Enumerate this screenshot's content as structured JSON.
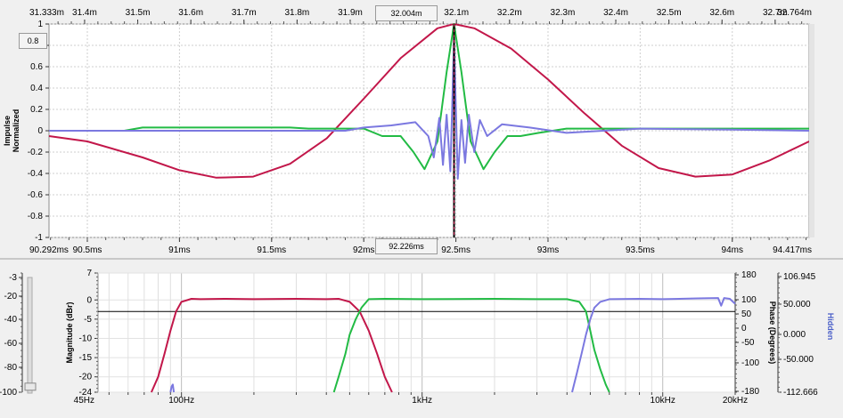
{
  "chart_data": [
    {
      "type": "line",
      "panel": "impulse",
      "ylabel": [
        "Impulse",
        "Normalized"
      ],
      "ylim": [
        -1,
        1
      ],
      "yticks": [
        "1",
        "0.8",
        "0.6",
        "0.4",
        "0.2",
        "0",
        "-0.2",
        "-0.4",
        "-0.6",
        "-0.8",
        "-1"
      ],
      "top_axis": {
        "start": "31.333m",
        "end": "32.764m",
        "ticks": [
          "31.4m",
          "31.5m",
          "31.6m",
          "31.7m",
          "31.8m",
          "31.9m",
          "32.1m",
          "32.2m",
          "32.3m",
          "32.4m",
          "32.5m",
          "32.6m",
          "32.7m"
        ],
        "marker": "32.004m"
      },
      "bottom_axis": {
        "start": "90.292ms",
        "end": "94.417ms",
        "ticks": [
          "90.5ms",
          "91ms",
          "91.5ms",
          "92ms",
          "92.5ms",
          "93ms",
          "93.5ms",
          "94ms"
        ],
        "marker": "92.226ms"
      },
      "left_box": "0.8",
      "cursor_ms": 92.49,
      "grid": true,
      "series": [
        {
          "color": "#c2174a",
          "x": [
            90.292,
            90.5,
            90.8,
            91.0,
            91.2,
            91.4,
            91.6,
            91.8,
            92.0,
            92.2,
            92.4,
            92.49,
            92.6,
            92.8,
            93.0,
            93.2,
            93.4,
            93.6,
            93.8,
            94.0,
            94.2,
            94.417
          ],
          "y": [
            -0.05,
            -0.1,
            -0.25,
            -0.37,
            -0.44,
            -0.43,
            -0.31,
            -0.07,
            0.3,
            0.68,
            0.96,
            1.0,
            0.96,
            0.77,
            0.48,
            0.16,
            -0.14,
            -0.35,
            -0.43,
            -0.41,
            -0.28,
            -0.1
          ]
        },
        {
          "color": "#22bb44",
          "x": [
            90.292,
            90.7,
            90.8,
            91.6,
            91.7,
            92.0,
            92.1,
            92.2,
            92.27,
            92.33,
            92.4,
            92.45,
            92.49,
            92.53,
            92.58,
            92.65,
            92.71,
            92.78,
            92.85,
            92.95,
            93.1,
            94.417
          ],
          "y": [
            0.0,
            0.0,
            0.03,
            0.03,
            0.02,
            0.02,
            -0.05,
            -0.05,
            -0.2,
            -0.36,
            -0.1,
            0.55,
            1.0,
            0.55,
            -0.1,
            -0.36,
            -0.2,
            -0.05,
            -0.05,
            -0.02,
            0.02,
            0.02
          ]
        },
        {
          "color": "#7b78e0",
          "x": [
            90.292,
            91.9,
            92.0,
            92.15,
            92.28,
            92.35,
            92.38,
            92.41,
            92.43,
            92.45,
            92.47,
            92.49,
            92.51,
            92.53,
            92.55,
            92.57,
            92.6,
            92.63,
            92.67,
            92.75,
            92.9,
            93.1,
            93.5,
            94.0,
            94.417
          ],
          "y": [
            0.0,
            0.0,
            0.03,
            0.05,
            0.08,
            -0.05,
            -0.25,
            0.12,
            -0.32,
            0.15,
            -0.38,
            0.85,
            -0.45,
            0.1,
            -0.3,
            0.15,
            -0.2,
            0.1,
            -0.05,
            0.06,
            0.03,
            -0.02,
            0.02,
            0.01,
            0.0
          ]
        }
      ]
    },
    {
      "type": "line",
      "panel": "magnitude",
      "xscale": "log",
      "xlim": [
        45,
        20000
      ],
      "xticks": [
        "45Hz",
        "100Hz",
        "1kHz",
        "10kHz",
        "20kHz"
      ],
      "ylabel": "Magnitude (dBr)",
      "ylim": [
        -24,
        7
      ],
      "yticks": [
        "7",
        "0",
        "-5",
        "-10",
        "-15",
        "-20",
        "-24"
      ],
      "phase_label": "Phase (Degrees)",
      "phase_ticks": [
        "180",
        "100",
        "50",
        "0",
        "-50",
        "-100",
        "-180"
      ],
      "hidden_label": "Hidden",
      "hidden_ticks": [
        "106.945",
        "50.000",
        "0.000",
        "-50.000",
        "-112.666"
      ],
      "level_ticks": [
        "-3",
        "-20",
        "-40",
        "-60",
        "-80",
        "-100"
      ],
      "level_fraction": 0.96,
      "reference_level": -3,
      "grid": true,
      "series": [
        {
          "color": "#c2174a",
          "x": [
            75,
            80,
            85,
            90,
            95,
            100,
            110,
            120,
            150,
            200,
            300,
            400,
            450,
            500,
            550,
            600,
            650,
            700,
            750
          ],
          "y": [
            -24,
            -20,
            -14,
            -8,
            -3,
            -0.5,
            0.3,
            0.2,
            0.3,
            0.2,
            0.3,
            0.2,
            0.3,
            -0.5,
            -3,
            -8,
            -14,
            -20,
            -24
          ]
        },
        {
          "color": "#22bb44",
          "x": [
            430,
            450,
            480,
            500,
            530,
            560,
            600,
            700,
            1000,
            2000,
            3000,
            4000,
            4500,
            4800,
            5000,
            5200,
            5500,
            5800,
            6000
          ],
          "y": [
            -24,
            -20,
            -14,
            -9,
            -5,
            -2,
            0.2,
            0.3,
            0.2,
            0.3,
            0.2,
            0.2,
            -0.5,
            -3,
            -8,
            -13,
            -18,
            -22,
            -24
          ]
        },
        {
          "color": "#7b78e0",
          "x": [
            4200,
            4400,
            4600,
            4800,
            5000,
            5200,
            5500,
            6000,
            8000,
            10000,
            14000,
            17000,
            17500,
            18000,
            19000,
            20000
          ],
          "y": [
            -24,
            -19,
            -14,
            -9,
            -5,
            -2,
            -0.5,
            0.2,
            0.3,
            0.2,
            0.4,
            0.5,
            -1.5,
            0.5,
            0.3,
            -1
          ]
        },
        {
          "color": "#7b78e0",
          "x": [
            90,
            91,
            92,
            93
          ],
          "y": [
            -24,
            -22.5,
            -22,
            -24
          ]
        }
      ]
    }
  ]
}
